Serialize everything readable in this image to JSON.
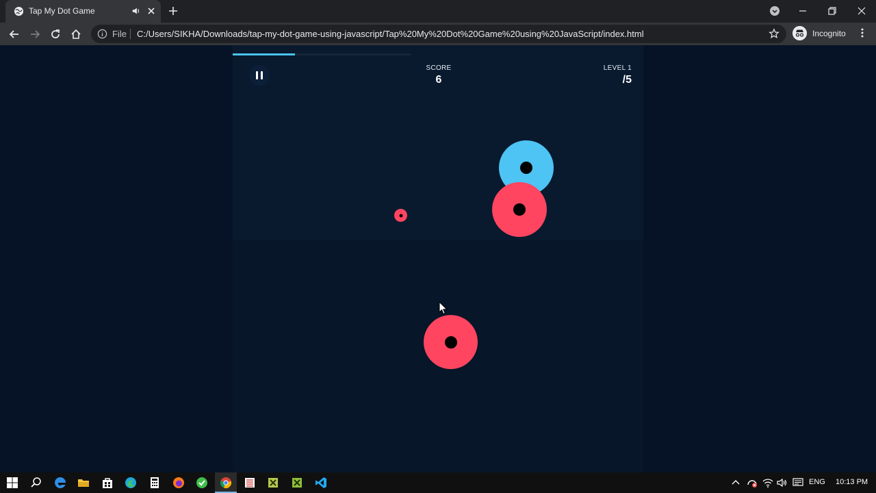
{
  "browser": {
    "tab_title": "Tap My Dot Game",
    "omnibox_scheme": "File",
    "url": "C:/Users/SIKHA/Downloads/tap-my-dot-game-using-javascript/Tap%20My%20Dot%20Game%20using%20JavaScript/index.html",
    "profile_label": "Incognito",
    "icons": [
      "globe-icon",
      "speaker-icon",
      "close-icon",
      "plus-icon",
      "back-arrow-icon",
      "forward-arrow-icon",
      "reload-icon",
      "home-icon",
      "info-icon",
      "star-icon",
      "incognito-icon",
      "kebab-menu-icon"
    ]
  },
  "game": {
    "score_label": "SCORE",
    "score_value": "6",
    "level_label": "LEVEL 1",
    "level_goal": "/5",
    "level_progress_percent": 35,
    "colors": {
      "red": "#ff4560",
      "blue": "#4dc4f4",
      "core": "#000000",
      "background": "#061326"
    }
  },
  "taskbar": {
    "language": "ENG",
    "time": "10:13 PM",
    "icons": [
      "windows-start-icon",
      "search-icon",
      "edge-legacy-icon",
      "file-explorer-icon",
      "store-icon",
      "edge-icon",
      "calculator-icon",
      "firefox-icon",
      "app-green-icon",
      "chrome-icon",
      "app-list-icon",
      "app-x-icon",
      "app-x2-icon",
      "vscode-icon"
    ]
  }
}
